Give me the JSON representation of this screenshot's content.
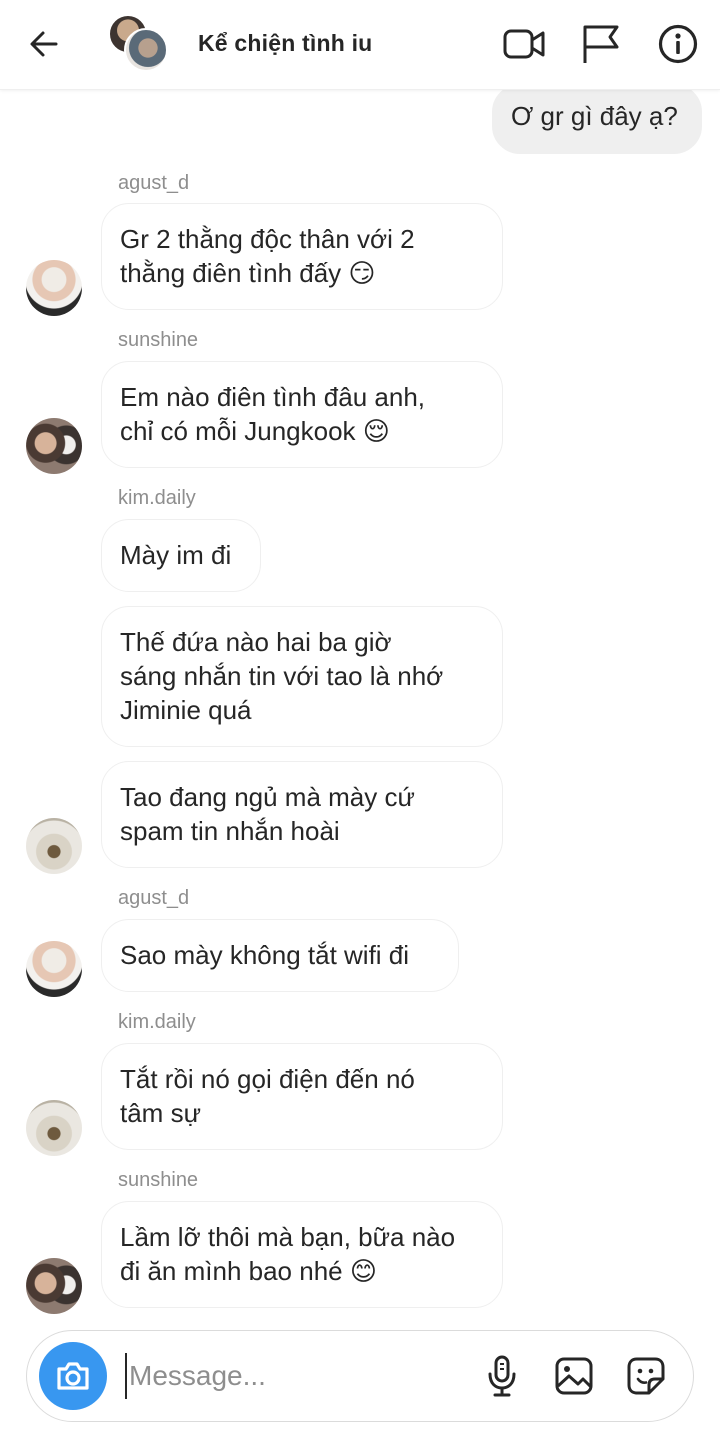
{
  "header": {
    "title": "Kể chiện tình iu",
    "icons": [
      "back-arrow-icon",
      "video-call-icon",
      "flag-icon",
      "info-icon"
    ]
  },
  "messages": [
    {
      "type": "own",
      "text": "Ơ gr gì đây ạ?"
    },
    {
      "type": "username",
      "text": "agust_d"
    },
    {
      "type": "incoming",
      "text": "Gr 2 thằng độc thân với 2\nthằng điên tình đấy 😏"
    },
    {
      "type": "username",
      "text": "sunshine"
    },
    {
      "type": "incoming",
      "text": "Em nào điên tình đâu anh,\nchỉ có mỗi Jungkook 😌"
    },
    {
      "type": "username",
      "text": "kim.daily"
    },
    {
      "type": "incoming",
      "text": "Mày im đi"
    },
    {
      "type": "incoming",
      "text": "Thế đứa nào hai ba giờ\nsáng nhắn tin với tao là nhớ\nJiminie quá"
    },
    {
      "type": "incoming",
      "text": "Tao đang ngủ mà mày cứ\nspam tin nhắn hoài"
    },
    {
      "type": "username",
      "text": "agust_d"
    },
    {
      "type": "incoming",
      "text": "Sao mày không tắt wifi đi"
    },
    {
      "type": "username",
      "text": "kim.daily"
    },
    {
      "type": "incoming",
      "text": "Tắt rồi nó gọi điện đến nó\ntâm sự"
    },
    {
      "type": "username",
      "text": "sunshine"
    },
    {
      "type": "incoming",
      "text": "Lầm lỡ thôi mà bạn, bữa nào\nđi ăn mình bao nhé 😊"
    }
  ],
  "composer": {
    "placeholder": "Message...",
    "icons": [
      "camera-icon",
      "microphone-icon",
      "gallery-icon",
      "sticker-icon"
    ],
    "camera_color": "#3897f0"
  },
  "colors": {
    "own_bubble": "#efefef",
    "bubble_border": "#efefef",
    "username_text": "#8e8e8e",
    "text": "#262626"
  }
}
